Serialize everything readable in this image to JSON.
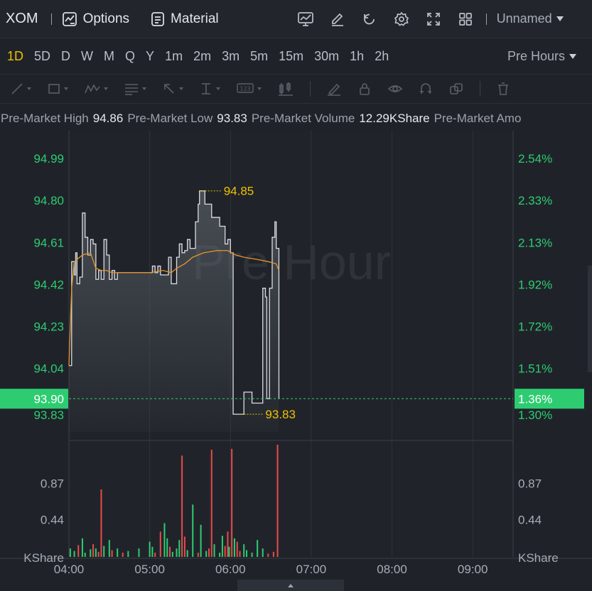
{
  "header": {
    "symbol": "XOM",
    "options_label": "Options",
    "material_label": "Material",
    "layout_name": "Unnamed"
  },
  "intervals": [
    "1D",
    "5D",
    "D",
    "W",
    "M",
    "Q",
    "Y",
    "1m",
    "2m",
    "3m",
    "5m",
    "15m",
    "30m",
    "1h",
    "2h"
  ],
  "active_interval": "1D",
  "session_selector": "Pre Hours",
  "stats": [
    {
      "label": "Pre-Market High",
      "value": "94.86"
    },
    {
      "label": "Pre-Market Low",
      "value": "93.83"
    },
    {
      "label": "Pre-Market Volume",
      "value": "12.29KShare"
    },
    {
      "label": "Pre-Market Amo",
      "value": ""
    }
  ],
  "colors": {
    "up": "#2ecc71",
    "down": "#e84b4b",
    "price_line": "#d9dde3",
    "avg_line": "#e8932a",
    "annotation": "#f0c000",
    "current_tag": "#2ecc71"
  },
  "chart_data": {
    "type": "line",
    "watermark": "Pre Hour",
    "price_axis": {
      "left_ticks": [
        "94.99",
        "94.80",
        "94.61",
        "94.42",
        "94.23",
        "94.04",
        "93.83"
      ],
      "right_ticks": [
        "2.54%",
        "2.33%",
        "2.13%",
        "1.92%",
        "1.72%",
        "1.51%",
        "1.30%"
      ],
      "range": [
        93.75,
        95.08
      ]
    },
    "current": {
      "price": "93.90",
      "percent": "1.36%",
      "value": 93.9
    },
    "high_label": "94.85",
    "low_label": "93.83",
    "time_ticks": [
      "04:00",
      "05:00",
      "06:00",
      "07:00",
      "08:00",
      "09:00"
    ],
    "time_range_minutes": [
      0,
      330
    ],
    "price_series": [
      [
        0,
        94.05
      ],
      [
        2,
        94.52
      ],
      [
        4,
        94.46
      ],
      [
        5,
        94.56
      ],
      [
        6,
        94.42
      ],
      [
        8,
        94.45
      ],
      [
        10,
        94.74
      ],
      [
        12,
        94.63
      ],
      [
        14,
        94.55
      ],
      [
        16,
        94.62
      ],
      [
        18,
        94.6
      ],
      [
        20,
        94.44
      ],
      [
        22,
        94.48
      ],
      [
        24,
        94.44
      ],
      [
        26,
        94.62
      ],
      [
        28,
        94.55
      ],
      [
        30,
        94.44
      ],
      [
        32,
        94.48
      ],
      [
        34,
        94.44
      ],
      [
        36,
        94.47
      ],
      [
        50,
        94.47
      ],
      [
        60,
        94.47
      ],
      [
        62,
        94.5
      ],
      [
        64,
        94.47
      ],
      [
        66,
        94.5
      ],
      [
        68,
        94.46
      ],
      [
        72,
        94.46
      ],
      [
        74,
        94.54
      ],
      [
        76,
        94.42
      ],
      [
        78,
        94.42
      ],
      [
        80,
        94.54
      ],
      [
        82,
        94.6
      ],
      [
        84,
        94.56
      ],
      [
        86,
        94.57
      ],
      [
        88,
        94.62
      ],
      [
        90,
        94.58
      ],
      [
        92,
        94.58
      ],
      [
        94,
        94.7
      ],
      [
        96,
        94.78
      ],
      [
        97,
        94.84
      ],
      [
        99,
        94.84
      ],
      [
        101,
        94.78
      ],
      [
        104,
        94.78
      ],
      [
        106,
        94.72
      ],
      [
        110,
        94.72
      ],
      [
        112,
        94.68
      ],
      [
        114,
        94.68
      ],
      [
        116,
        94.6
      ],
      [
        118,
        94.62
      ],
      [
        120,
        94.56
      ],
      [
        122,
        93.83
      ],
      [
        128,
        93.83
      ],
      [
        130,
        93.93
      ],
      [
        134,
        93.93
      ],
      [
        136,
        93.88
      ],
      [
        142,
        93.88
      ],
      [
        144,
        94.4
      ],
      [
        146,
        94.36
      ],
      [
        147,
        93.9
      ],
      [
        149,
        94.4
      ],
      [
        151,
        94.63
      ],
      [
        153,
        94.7
      ],
      [
        154,
        94.58
      ],
      [
        156,
        93.9
      ]
    ],
    "avg_series": [
      [
        0,
        94.05
      ],
      [
        2,
        94.4
      ],
      [
        4,
        94.52
      ],
      [
        6,
        94.53
      ],
      [
        10,
        94.55
      ],
      [
        16,
        94.56
      ],
      [
        20,
        94.49
      ],
      [
        24,
        94.48
      ],
      [
        28,
        94.48
      ],
      [
        32,
        94.47
      ],
      [
        40,
        94.47
      ],
      [
        60,
        94.47
      ],
      [
        70,
        94.48
      ],
      [
        76,
        94.47
      ],
      [
        80,
        94.49
      ],
      [
        86,
        94.51
      ],
      [
        92,
        94.54
      ],
      [
        100,
        94.56
      ],
      [
        110,
        94.57
      ],
      [
        118,
        94.57
      ],
      [
        124,
        94.55
      ],
      [
        130,
        94.54
      ],
      [
        140,
        94.53
      ],
      [
        148,
        94.52
      ],
      [
        154,
        94.51
      ],
      [
        156,
        94.48
      ]
    ],
    "volume_axis": {
      "ticks": [
        "0.87",
        "0.44"
      ],
      "unit": "KShare",
      "range": [
        0,
        1.33
      ]
    },
    "volume": [
      [
        1,
        0.1,
        "up"
      ],
      [
        4,
        0.07,
        "up"
      ],
      [
        7,
        0.14,
        "down"
      ],
      [
        10,
        0.22,
        "up"
      ],
      [
        12,
        0.05,
        "up"
      ],
      [
        16,
        0.09,
        "up"
      ],
      [
        18,
        0.15,
        "down"
      ],
      [
        20,
        0.1,
        "up"
      ],
      [
        22,
        0.06,
        "down"
      ],
      [
        24,
        0.8,
        "down"
      ],
      [
        26,
        0.13,
        "up"
      ],
      [
        30,
        0.2,
        "up"
      ],
      [
        32,
        0.08,
        "down"
      ],
      [
        36,
        0.1,
        "up"
      ],
      [
        40,
        0.05,
        "down"
      ],
      [
        44,
        0.07,
        "up"
      ],
      [
        52,
        0.1,
        "up"
      ],
      [
        60,
        0.18,
        "up"
      ],
      [
        62,
        0.12,
        "up"
      ],
      [
        64,
        0.05,
        "down"
      ],
      [
        68,
        0.3,
        "down"
      ],
      [
        71,
        0.4,
        "up"
      ],
      [
        73,
        0.22,
        "up"
      ],
      [
        75,
        0.12,
        "down"
      ],
      [
        77,
        0.06,
        "up"
      ],
      [
        80,
        0.1,
        "up"
      ],
      [
        82,
        0.2,
        "up"
      ],
      [
        84,
        1.2,
        "down"
      ],
      [
        86,
        0.24,
        "down"
      ],
      [
        88,
        0.08,
        "up"
      ],
      [
        92,
        0.62,
        "up"
      ],
      [
        96,
        0.05,
        "down"
      ],
      [
        98,
        0.38,
        "up"
      ],
      [
        102,
        0.07,
        "up"
      ],
      [
        104,
        0.1,
        "down"
      ],
      [
        106,
        1.27,
        "down"
      ],
      [
        108,
        0.15,
        "up"
      ],
      [
        112,
        0.05,
        "up"
      ],
      [
        114,
        0.25,
        "up"
      ],
      [
        116,
        0.13,
        "down"
      ],
      [
        118,
        0.3,
        "down"
      ],
      [
        119,
        0.12,
        "up"
      ],
      [
        121,
        1.28,
        "down"
      ],
      [
        123,
        0.22,
        "up"
      ],
      [
        125,
        0.18,
        "down"
      ],
      [
        127,
        0.07,
        "down"
      ],
      [
        130,
        0.15,
        "up"
      ],
      [
        132,
        0.08,
        "up"
      ],
      [
        136,
        0.05,
        "up"
      ],
      [
        140,
        0.2,
        "up"
      ],
      [
        144,
        0.1,
        "up"
      ],
      [
        148,
        0.04,
        "down"
      ],
      [
        152,
        0.06,
        "down"
      ],
      [
        155,
        1.33,
        "down"
      ]
    ]
  }
}
